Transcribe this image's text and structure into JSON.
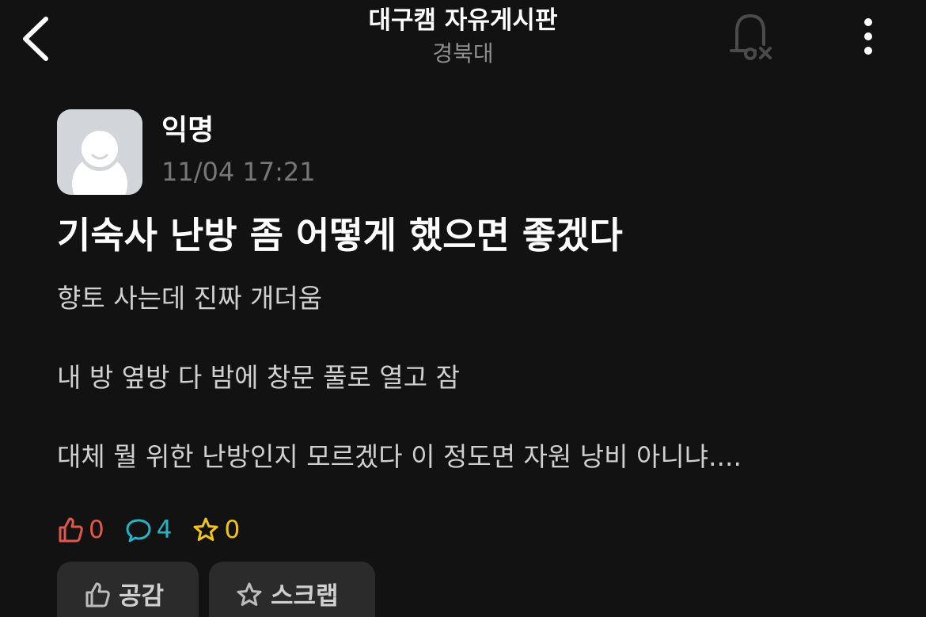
{
  "header": {
    "title": "대구캠 자유게시판",
    "subtitle": "경북대",
    "back_icon": "chevron-left-icon",
    "notification_icon": "bell-off-icon",
    "more_icon": "more-vertical-icon"
  },
  "author": {
    "name": "익명",
    "time": "11/04 17:21",
    "avatar_icon": "anonymous-avatar-icon"
  },
  "post": {
    "title": "기숙사 난방 좀 어떻게 했으면 좋겠다",
    "lines": [
      "향토 사는데 진짜 개더움",
      "내 방 옆방 다 밤에 창문 풀로 열고 잠",
      "대체 뭘 위한 난방인지 모르겠다 이 정도면 자원 낭비 아니냐...."
    ]
  },
  "stats": {
    "likes": "0",
    "comments": "4",
    "scraps": "0"
  },
  "actions": {
    "like_label": "공감",
    "scrap_label": "스크랩"
  },
  "colors": {
    "background": "#121212",
    "like": "#e0584c",
    "comment": "#27b3c6",
    "scrap": "#f0c419",
    "button_bg": "#2b2b2b"
  }
}
